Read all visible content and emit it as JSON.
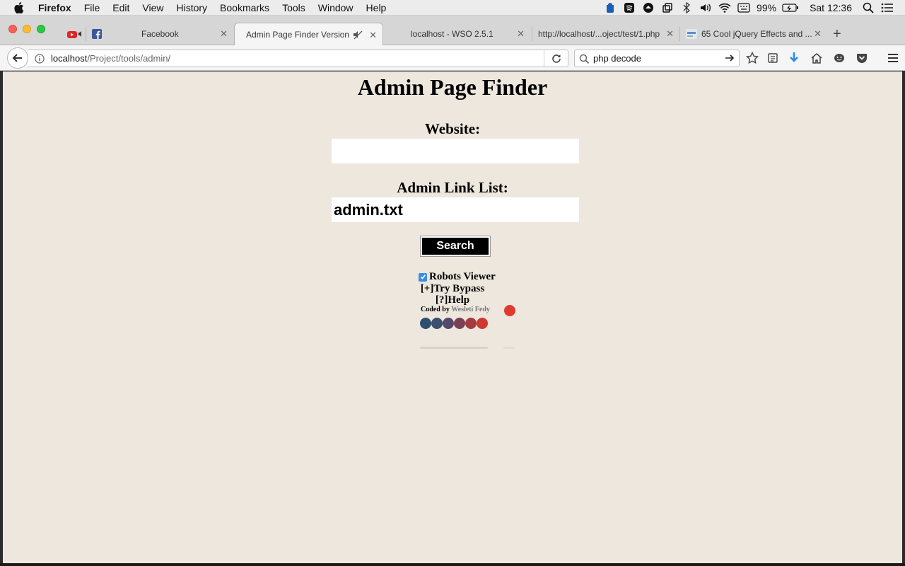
{
  "menubar": {
    "app_name": "Firefox",
    "items": [
      "File",
      "Edit",
      "View",
      "History",
      "Bookmarks",
      "Tools",
      "Window",
      "Help"
    ],
    "battery": "99%",
    "clock": "Sat 12:36"
  },
  "tabs": [
    {
      "label": "Facebook"
    },
    {
      "label": "Admin Page Finder Version"
    },
    {
      "label": "localhost - WSO 2.5.1"
    },
    {
      "label": "http://localhost/...oject/test/1.php"
    },
    {
      "label": "65 Cool jQuery Effects and ..."
    }
  ],
  "urlbar": {
    "host": "localhost",
    "path": "/Project/tools/admin/"
  },
  "searchbar": {
    "query": "php decode"
  },
  "page": {
    "title": "Admin Page Finder",
    "website_label": "Website:",
    "website_value": "",
    "list_label": "Admin Link List:",
    "list_value": "admin.txt",
    "search_button": "Search",
    "robots_label": "Robots Viewer",
    "robots_checked": true,
    "bypass_link": "[+]Try Bypass",
    "help_link": "[?]Help",
    "coded_by": "Coded by",
    "author": "Wesleti Fedy"
  },
  "colors": {
    "page_bg": "#ede7de",
    "accent_checkbox": "#3b8ce5",
    "dots": [
      "#2f4f6f",
      "#3b4f6e",
      "#55486a",
      "#7a3f55",
      "#a63b3f",
      "#d0392f",
      "#de3b2c"
    ]
  }
}
